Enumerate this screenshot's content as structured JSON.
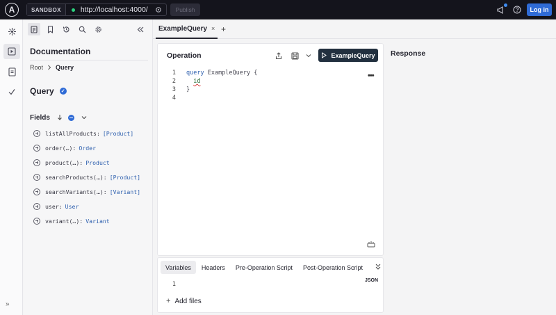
{
  "topbar": {
    "logo_letter": "A",
    "sandbox_label": "SANDBOX",
    "endpoint_url": "http://localhost:4000/",
    "publish_label": "Publish",
    "login_label": "Log in"
  },
  "docs": {
    "title": "Documentation",
    "breadcrumb": [
      "Root",
      "Query"
    ],
    "type_name": "Query",
    "fields_label": "Fields",
    "fields": [
      {
        "name": "listAllProducts:",
        "type": "[Product]"
      },
      {
        "name": "order(…):",
        "type": "Order"
      },
      {
        "name": "product(…):",
        "type": "Product"
      },
      {
        "name": "searchProducts(…):",
        "type": "[Product]"
      },
      {
        "name": "searchVariants(…):",
        "type": "[Variant]"
      },
      {
        "name": "user:",
        "type": "User"
      },
      {
        "name": "variant(…):",
        "type": "Variant"
      }
    ],
    "collapse_glyph": "»"
  },
  "tabs": {
    "active_tab": "ExampleQuery",
    "close_glyph": "×",
    "new_tab_glyph": "+"
  },
  "operation": {
    "title": "Operation",
    "run_label": "ExampleQuery",
    "more_glyph": "•••",
    "line_numbers": [
      "1",
      "2",
      "3",
      "4"
    ],
    "code": {
      "keyword": "query",
      "name": " ExampleQuery {",
      "field": "id",
      "close": "}"
    }
  },
  "variables": {
    "tabs": [
      "Variables",
      "Headers",
      "Pre-Operation Script",
      "Post-Operation Script"
    ],
    "json_tag": "JSON",
    "line_number": "1",
    "add_files_label": "Add files",
    "add_glyph": "+"
  },
  "response": {
    "title": "Response"
  },
  "colors": {
    "topbar": "#14141c",
    "primary_blue": "#2f6bd6",
    "run_button": "#22303f",
    "keyword_blue": "#2d5fae",
    "status_dot": "#2bd17e"
  }
}
